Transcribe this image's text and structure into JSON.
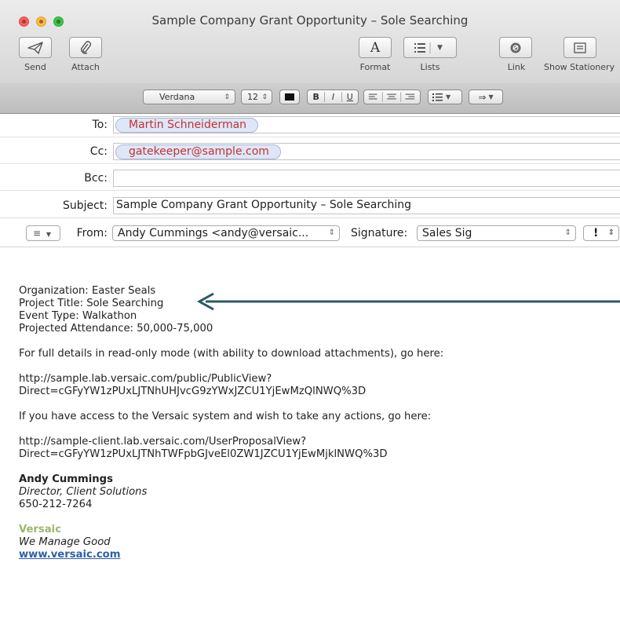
{
  "window": {
    "title": "Sample Company Grant Opportunity – Sole Searching"
  },
  "toolbar": {
    "send": "Send",
    "attach": "Attach",
    "format": "Format",
    "lists": "Lists",
    "link": "Link",
    "show_stationery": "Show Stationery",
    "format_glyph": "A"
  },
  "format_bar": {
    "font": "Verdana",
    "size": "12",
    "bold": "B",
    "italic": "I",
    "underline": "U"
  },
  "header": {
    "to_label": "To:",
    "to_value": "Martin Schneiderman",
    "cc_label": "Cc:",
    "cc_value": "gatekeeper@sample.com",
    "bcc_label": "Bcc:",
    "bcc_value": "",
    "subject_label": "Subject:",
    "subject_value": "Sample Company Grant Opportunity – Sole Searching",
    "from_label": "From:",
    "from_value": "Andy Cummings <andy@versaic...",
    "signature_label": "Signature:",
    "signature_value": "Sales Sig",
    "priority_value": "!"
  },
  "body": {
    "org": "Organization: Easter Seals",
    "project": "Project Title: Sole Searching",
    "event": "Event Type: Walkathon",
    "attendance": "Projected Attendance: 50,000-75,000",
    "details_intro": "For full details in read-only mode (with ability to download attachments), go here:",
    "url1_a": "http://sample.lab.versaic.com/public/PublicView?",
    "url1_b": "Direct=cGFyYW1zPUxLJTNhUHJvcG9zYWxJZCU1YjEwMzQlNWQ%3D",
    "access_intro": "If you have access to the Versaic system and wish to take any actions, go here:",
    "url2_a": "http://sample-client.lab.versaic.com/UserProposalView?",
    "url2_b": "Direct=cGFyYW1zPUxLJTNhTWFpbGJveEl0ZW1JZCU1YjEwMjklNWQ%3D",
    "sig_name": "Andy Cummings",
    "sig_title": "Director, Client Solutions",
    "sig_phone": "650-212-7264",
    "brand": "Versaic",
    "tagline": "We Manage Good",
    "website": "www.versaic.com"
  },
  "colors": {
    "annotation_arrow": "#2c5a60",
    "token_text": "#c03333",
    "brand_green": "#9cb66a",
    "link_blue": "#2f5fa8"
  }
}
